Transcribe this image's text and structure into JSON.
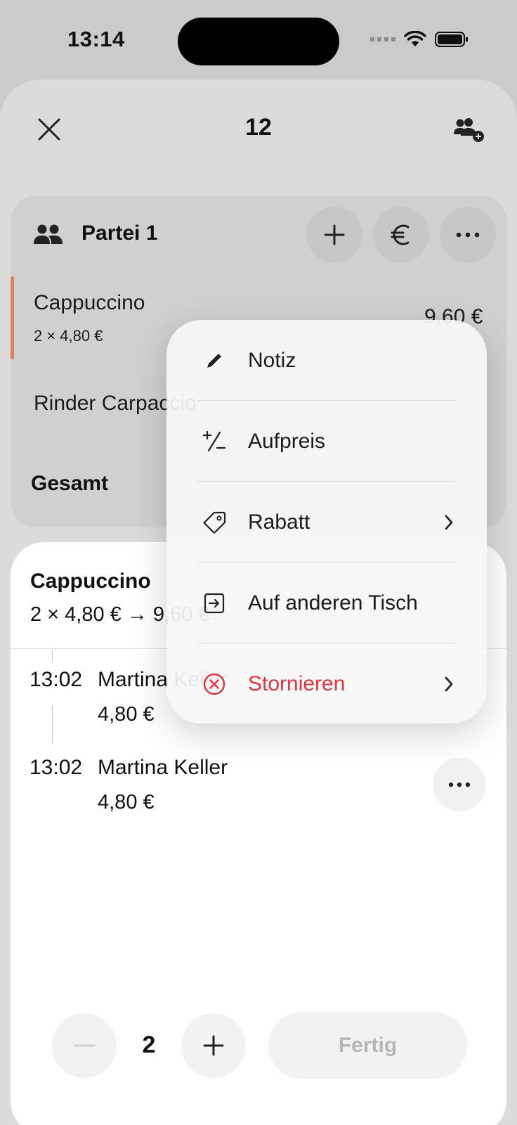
{
  "status_bar": {
    "time": "13:14"
  },
  "header": {
    "title": "12"
  },
  "party": {
    "name": "Partei 1",
    "items": [
      {
        "name": "Cappuccino",
        "detail": "2 × 4,80 €",
        "price": "9,60 €"
      },
      {
        "name": "Rinder Carpaccio",
        "price": ""
      }
    ],
    "total_label": "Gesamt"
  },
  "detail": {
    "title": "Cappuccino",
    "formula": "2 × 4,80 € → 9,60 €",
    "log": [
      {
        "time": "13:02",
        "user": "Martina Keller",
        "amount": "4,80 €"
      },
      {
        "time": "13:02",
        "user": "Martina Keller",
        "amount": "4,80 €"
      }
    ]
  },
  "controls": {
    "quantity": "2",
    "done_label": "Fertig"
  },
  "menu": {
    "items": [
      {
        "label": "Notiz",
        "icon": "pencil-icon"
      },
      {
        "label": "Aufpreis",
        "icon": "plus-minus-icon"
      },
      {
        "label": "Rabatt",
        "icon": "tag-icon"
      },
      {
        "label": "Auf anderen Tisch",
        "icon": "move-to-table-icon"
      },
      {
        "label": "Stornieren",
        "icon": "cancel-circle-icon"
      }
    ]
  },
  "colors": {
    "accent": "#d8825a",
    "danger": "#e0343f"
  }
}
